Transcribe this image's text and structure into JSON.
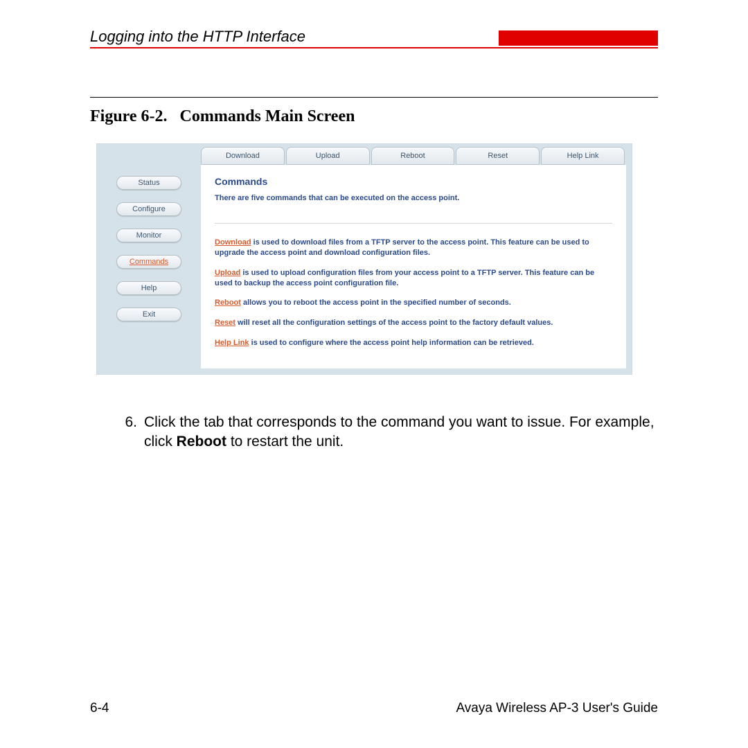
{
  "header": {
    "title": "Logging into the HTTP Interface"
  },
  "figure": {
    "label": "Figure 6-2.",
    "title": "Commands Main Screen"
  },
  "screenshot": {
    "tabs": [
      "Download",
      "Upload",
      "Reboot",
      "Reset",
      "Help Link"
    ],
    "sidebar": [
      "Status",
      "Configure",
      "Monitor",
      "Commands",
      "Help",
      "Exit"
    ],
    "sidebar_active_index": 3,
    "heading": "Commands",
    "intro": "There are five commands that can be executed on the access point.",
    "items": [
      {
        "link": "Download",
        "text": " is used to download files from a TFTP server to the access point. This feature can be used to upgrade the access point and download configuration files."
      },
      {
        "link": "Upload",
        "text": " is used to upload configuration files from your access point to a TFTP server. This feature can be used to backup the access point configuration file."
      },
      {
        "link": "Reboot",
        "text": " allows you to reboot the access point in the specified number of seconds."
      },
      {
        "link": "Reset",
        "text": " will reset all the configuration settings of the access point to the factory default values."
      },
      {
        "link": "Help Link",
        "text": " is used to configure where the access point help information can be retrieved."
      }
    ]
  },
  "step": {
    "number": "6.",
    "text_before": "Click the tab that corresponds to the command you want to issue. For example, click ",
    "bold": "Reboot",
    "text_after": " to restart the unit."
  },
  "footer": {
    "page": "6-4",
    "doc": "Avaya Wireless AP-3 User's Guide"
  }
}
